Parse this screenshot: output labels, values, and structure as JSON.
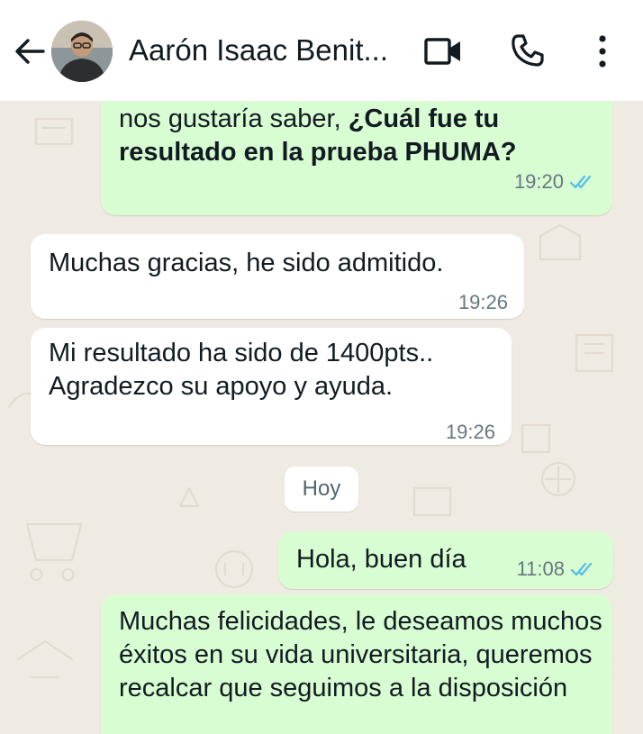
{
  "header": {
    "contact_name": "Aarón Isaac Benit..."
  },
  "messages": [
    {
      "direction": "out",
      "text_plain": "nos gustaría saber, ",
      "text_bold": "¿Cuál fue tu resultado en la prueba PHUMA?",
      "time": "19:20",
      "status": "read"
    },
    {
      "direction": "in",
      "text": "Muchas gracias, he sido admitido.",
      "time": "19:26"
    },
    {
      "direction": "in",
      "text_line1": "Mi resultado ha sido de 1400pts..",
      "text_line2": "Agradezco su apoyo y ayuda.",
      "time": "19:26"
    },
    {
      "direction": "out",
      "text": "Hola, buen día",
      "time": "11:08",
      "status": "read"
    },
    {
      "direction": "out",
      "text": "Muchas felicidades, le deseamos muchos éxitos en su vida universitaria,  queremos recalcar que seguimos a la disposición"
    }
  ],
  "day_separator": "Hoy",
  "colors": {
    "outgoing_bubble": "#d9fdd3",
    "incoming_bubble": "#ffffff",
    "read_ticks": "#53bdeb",
    "wallpaper": "#efeae2"
  },
  "icons": [
    "back-arrow-icon",
    "video-call-icon",
    "phone-call-icon",
    "more-options-icon",
    "double-check-icon"
  ]
}
